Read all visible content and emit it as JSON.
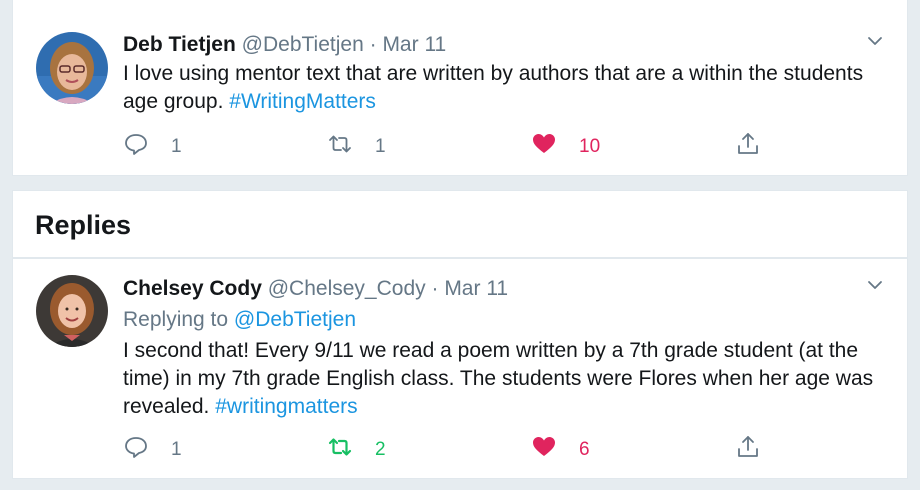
{
  "tweets": [
    {
      "name": "Deb Tietjen",
      "handle": "@DebTietjen",
      "dot": "·",
      "date": "Mar 11",
      "text": "I love using mentor text that are written by authors that are a within the students age group.",
      "hashtag": "#WritingMatters",
      "replies": "1",
      "retweets": "1",
      "likes": "10",
      "liked": true,
      "retweeted": false
    },
    {
      "name": "Chelsey Cody",
      "handle": "@Chelsey_Cody",
      "dot": "·",
      "date": "Mar 11",
      "replying_label": "Replying to",
      "replying_to": "@DebTietjen",
      "text": "I second that! Every 9/11 we read a poem written by a 7th grade student (at the time) in my 7th grade English class. The students were Flores when her age was revealed.",
      "hashtag": "#writingmatters",
      "replies": "1",
      "retweets": "2",
      "likes": "6",
      "liked": true,
      "retweeted": true
    }
  ],
  "replies_heading": "Replies",
  "colors": {
    "link": "#1b95e0",
    "like": "#e0245e",
    "retweet": "#17bf63",
    "muted": "#657786",
    "background": "#e6ecf0"
  },
  "icons": [
    "reply-icon",
    "retweet-icon",
    "heart-icon",
    "share-icon",
    "chevron-down-icon"
  ]
}
